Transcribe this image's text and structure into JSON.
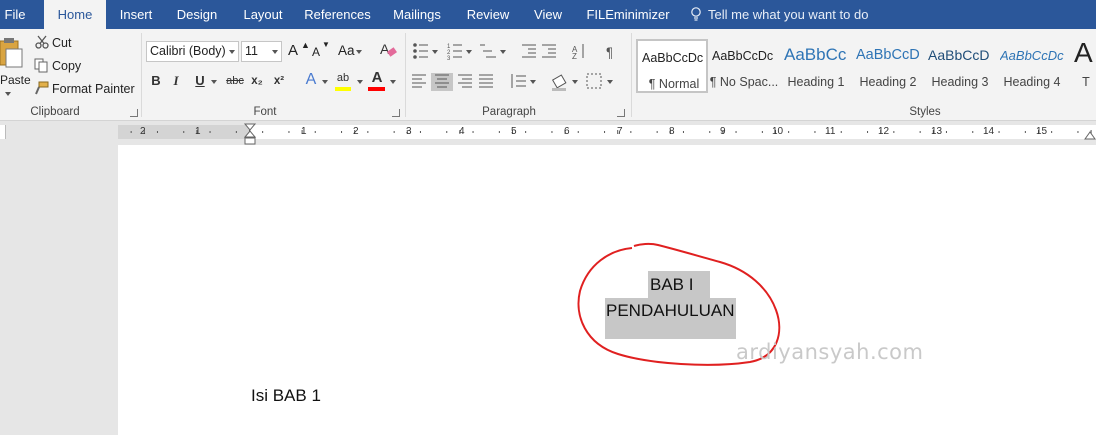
{
  "tabs": [
    {
      "label": "File"
    },
    {
      "label": "Home"
    },
    {
      "label": "Insert"
    },
    {
      "label": "Design"
    },
    {
      "label": "Layout"
    },
    {
      "label": "References"
    },
    {
      "label": "Mailings"
    },
    {
      "label": "Review"
    },
    {
      "label": "View"
    },
    {
      "label": "FILEminimizer"
    }
  ],
  "tell_me": "Tell me what you want to do",
  "clipboard": {
    "paste": "Paste",
    "cut": "Cut",
    "copy": "Copy",
    "format_painter": "Format Painter",
    "group_label": "Clipboard"
  },
  "font": {
    "name": "Calibri (Body)",
    "size": "11",
    "bold": "B",
    "italic": "I",
    "underline": "U",
    "strike": "abc",
    "subscript": "x₂",
    "superscript": "x²",
    "case": "Aa",
    "grow": "A",
    "shrink": "A",
    "text_effects": "A",
    "highlight": "ab",
    "font_color": "A",
    "group_label": "Font"
  },
  "paragraph": {
    "group_label": "Paragraph"
  },
  "styles": {
    "group_label": "Styles",
    "items": [
      {
        "preview": "AaBbCcDc",
        "label": "¶ Normal"
      },
      {
        "preview": "AaBbCcDc",
        "label": "¶ No Spac..."
      },
      {
        "preview": "AaBbCc",
        "label": "Heading 1"
      },
      {
        "preview": "AaBbCcD",
        "label": "Heading 2"
      },
      {
        "preview": "AaBbCcD",
        "label": "Heading 3"
      },
      {
        "preview": "AaBbCcDc",
        "label": "Heading 4"
      },
      {
        "preview": "A",
        "label": "T"
      }
    ]
  },
  "ruler": {
    "numbers": [
      "2",
      "1",
      "1",
      "2",
      "3",
      "4",
      "5",
      "6",
      "7",
      "8",
      "9",
      "10",
      "11",
      "12",
      "13",
      "14",
      "15"
    ]
  },
  "document": {
    "line1": "BAB I",
    "line2": "PENDAHULUAN",
    "body": "Isi BAB 1",
    "watermark": "ardiyansyah.com"
  },
  "colors": {
    "tab_bar": "#2b579a",
    "ribbon": "#f3f3f3",
    "selection": "#c7c7c7",
    "annotation": "#e02020",
    "highlight_bar": "#ffff00",
    "font_color_bar": "#ff0000"
  }
}
